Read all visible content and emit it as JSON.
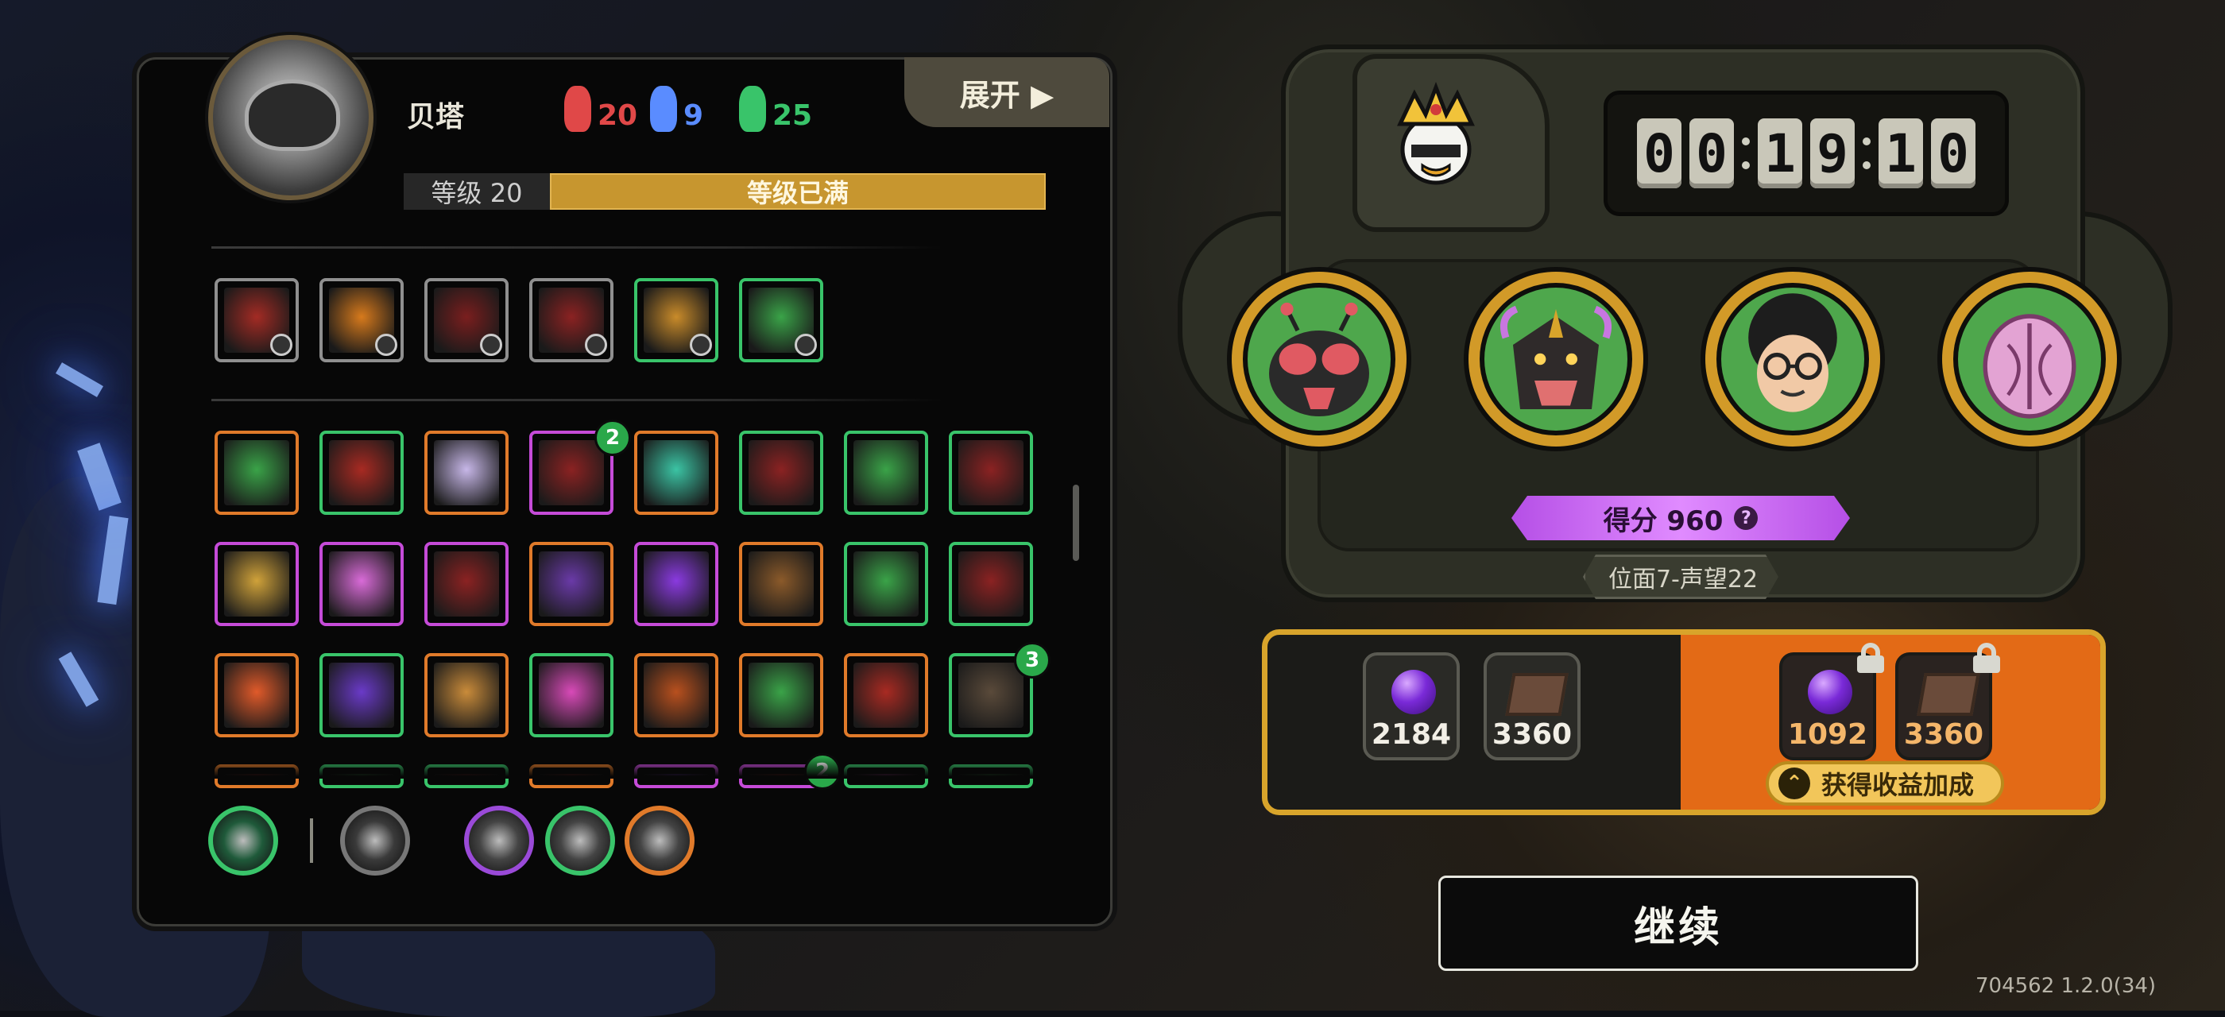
{
  "character": {
    "name": "贝塔",
    "stats": [
      {
        "value": "20",
        "color": "#e04848",
        "icon": "red-horn-icon"
      },
      {
        "value": "9",
        "color": "#5a8cff",
        "icon": "blue-horn-icon"
      },
      {
        "value": "25",
        "color": "#39c46a",
        "icon": "green-horn-icon"
      }
    ],
    "level_label": "等级 20",
    "level_status": "等级已满",
    "level_progress": 1.0
  },
  "panel": {
    "expand_label": "展开 ▶"
  },
  "equipped_skills": [
    {
      "name": "skill-claw",
      "border": "#8f8f8f",
      "color": "#a32b24"
    },
    {
      "name": "skill-flame-helm",
      "border": "#8f8f8f",
      "color": "#d77a1c"
    },
    {
      "name": "skill-dark-orb",
      "border": "#8f8f8f",
      "color": "#7a1e1e"
    },
    {
      "name": "skill-armor",
      "border": "#8f8f8f",
      "color": "#8b2222"
    },
    {
      "name": "skill-golden-path",
      "border": "#39c46a",
      "color": "#c98b2a"
    },
    {
      "name": "skill-vines",
      "border": "#39c46a",
      "color": "#3aa348"
    }
  ],
  "skill_grid": [
    {
      "border": "#e07a2a",
      "color": "#3aa348"
    },
    {
      "border": "#39c46a",
      "color": "#a82a22"
    },
    {
      "border": "#e07a2a",
      "color": "#c7b7e8"
    },
    {
      "border": "#c54bd8",
      "color": "#8b2222",
      "badge": "2"
    },
    {
      "border": "#e07a2a",
      "color": "#3bc4a4"
    },
    {
      "border": "#39c46a",
      "color": "#8b2222"
    },
    {
      "border": "#39c46a",
      "color": "#3aa348"
    },
    {
      "border": "#39c46a",
      "color": "#8b2222"
    },
    {
      "border": "#c54bd8",
      "color": "#d0a23a"
    },
    {
      "border": "#c54bd8",
      "color": "#d96bd8"
    },
    {
      "border": "#c54bd8",
      "color": "#8b2222"
    },
    {
      "border": "#e07a2a",
      "color": "#6a3aa8"
    },
    {
      "border": "#c54bd8",
      "color": "#8a3ae0"
    },
    {
      "border": "#e07a2a",
      "color": "#8b5a2a"
    },
    {
      "border": "#39c46a",
      "color": "#3aa348"
    },
    {
      "border": "#39c46a",
      "color": "#8b2222"
    },
    {
      "border": "#e07a2a",
      "color": "#e05a2a"
    },
    {
      "border": "#39c46a",
      "color": "#6a3ac8"
    },
    {
      "border": "#e07a2a",
      "color": "#c98b3a"
    },
    {
      "border": "#39c46a",
      "color": "#d84ab8"
    },
    {
      "border": "#e07a2a",
      "color": "#b8501e"
    },
    {
      "border": "#e07a2a",
      "color": "#3aa348"
    },
    {
      "border": "#e07a2a",
      "color": "#a82a22"
    },
    {
      "border": "#39c46a",
      "color": "#5a4a3a",
      "badge": "3"
    },
    {
      "border": "#e07a2a",
      "color": "#a82a22"
    },
    {
      "border": "#39c46a",
      "color": "#3aa348"
    },
    {
      "border": "#39c46a",
      "color": "#8b2222"
    },
    {
      "border": "#e07a2a",
      "color": "#a82a22"
    },
    {
      "border": "#c54bd8",
      "color": "#8a3ae0"
    },
    {
      "border": "#c54bd8",
      "color": "#a82a22",
      "badge": "2"
    },
    {
      "border": "#39c46a",
      "color": "#d84ab8"
    },
    {
      "border": "#39c46a",
      "color": "#3aa348"
    }
  ],
  "runes": [
    {
      "name": "rune-green-spirit",
      "border": "#39c46a",
      "color": "#1f5a3a"
    },
    {
      "name": "rune-dark-totem",
      "border": "#777",
      "color": "#3a3a3a"
    },
    {
      "name": "rune-purple-check",
      "border": "#9a4ad8",
      "color": "#444"
    },
    {
      "name": "rune-green-triangle",
      "border": "#39c46a",
      "color": "#444"
    },
    {
      "name": "rune-orange-check",
      "border": "#e07a2a",
      "color": "#444"
    }
  ],
  "hud": {
    "timer_digits": [
      "0",
      "0",
      "1",
      "9",
      "1",
      "0"
    ],
    "score_label": "得分 960",
    "score_help": "?",
    "plane_label": "位面7-声望22",
    "portraits": [
      {
        "name": "portrait-bug"
      },
      {
        "name": "portrait-fanged-mask"
      },
      {
        "name": "portrait-curly-glasses"
      },
      {
        "name": "portrait-pink-pod"
      }
    ]
  },
  "rewards": {
    "base": [
      {
        "icon": "purple-gem-icon",
        "value": "2184"
      },
      {
        "icon": "book-icon",
        "value": "3360"
      }
    ],
    "locked": [
      {
        "icon": "purple-gem-icon",
        "value": "1092"
      },
      {
        "icon": "book-icon",
        "value": "3360"
      }
    ],
    "bonus_label": "获得收益加成"
  },
  "continue_label": "继续",
  "version": "704562 1.2.0(34)"
}
